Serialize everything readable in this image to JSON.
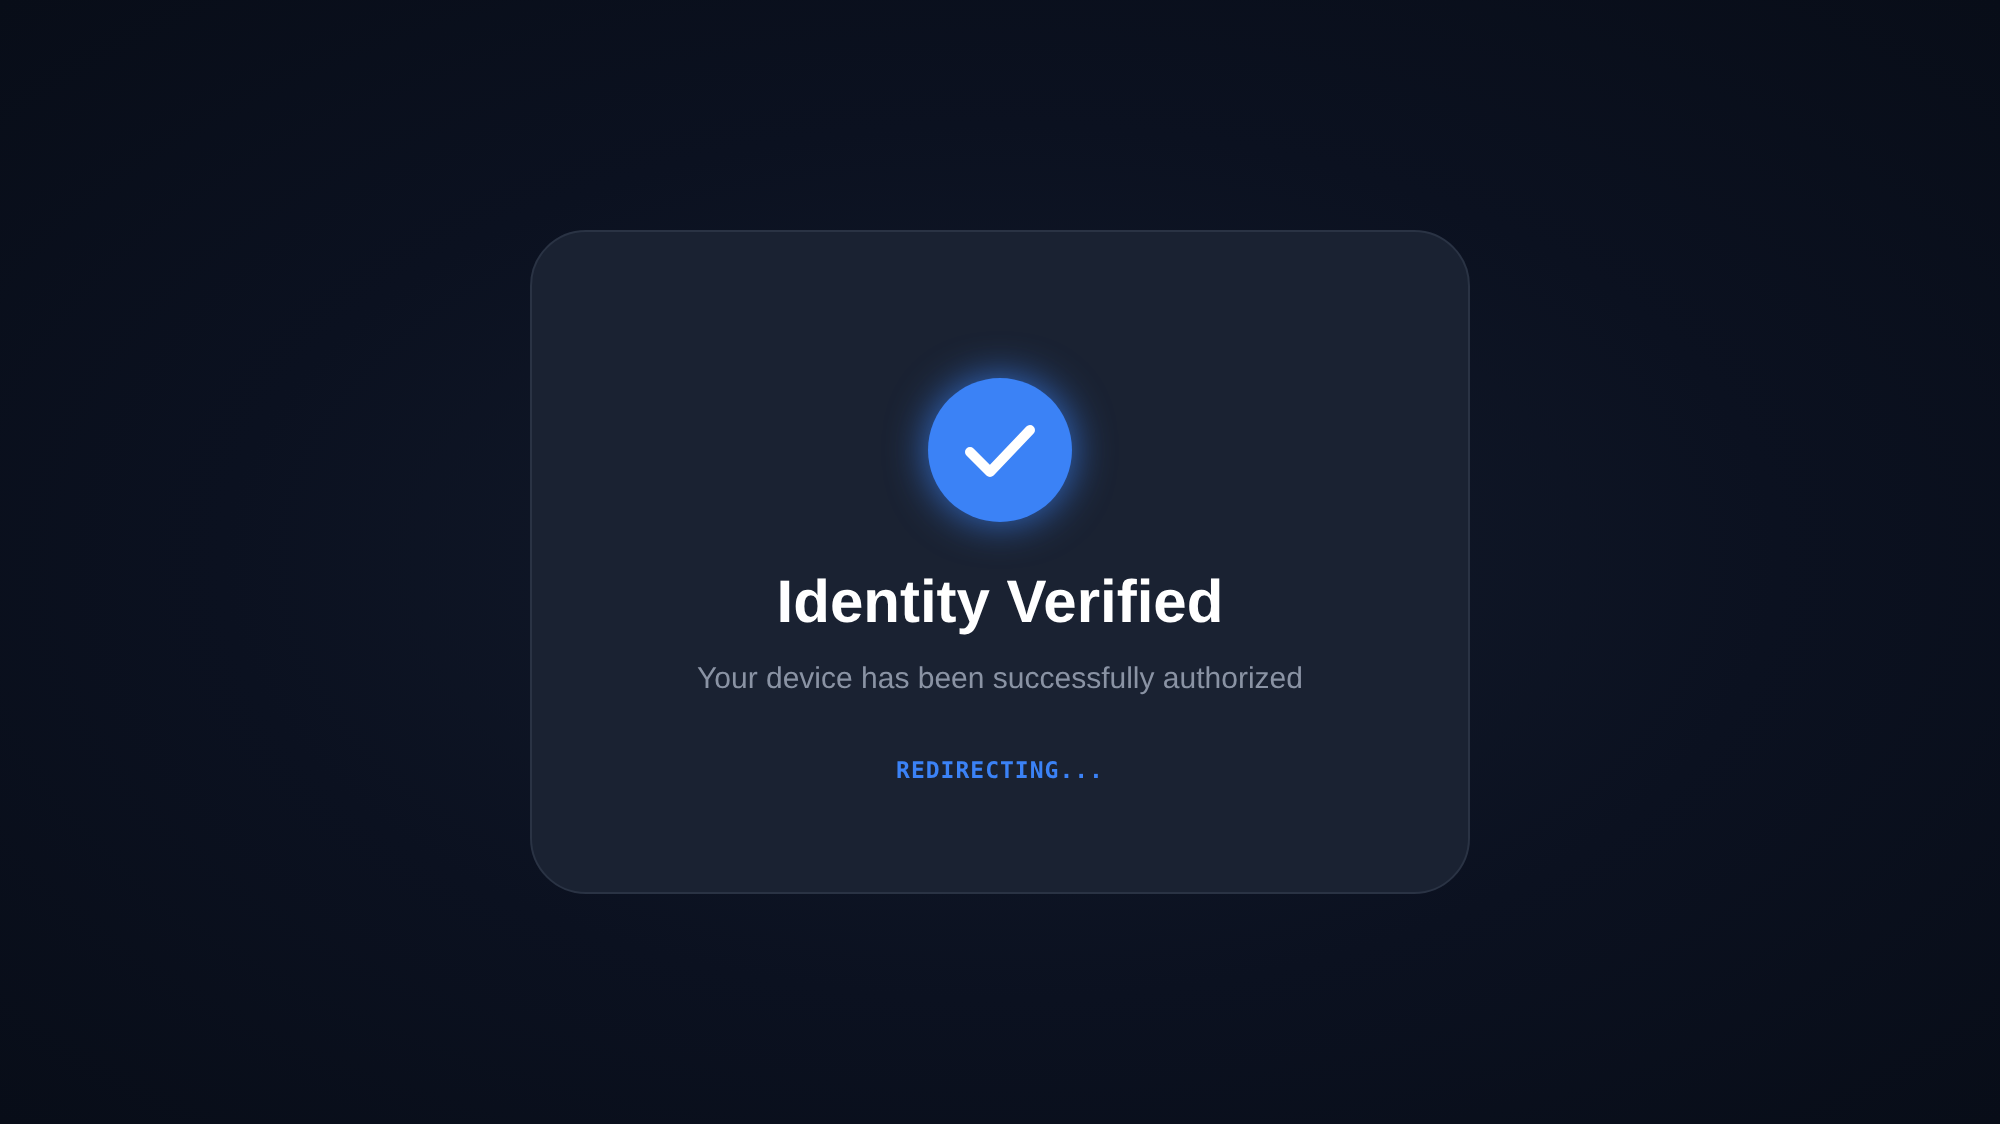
{
  "dialog": {
    "title": "Identity Verified",
    "message": "Your device has been successfully authorized",
    "status": "REDIRECTING..."
  }
}
